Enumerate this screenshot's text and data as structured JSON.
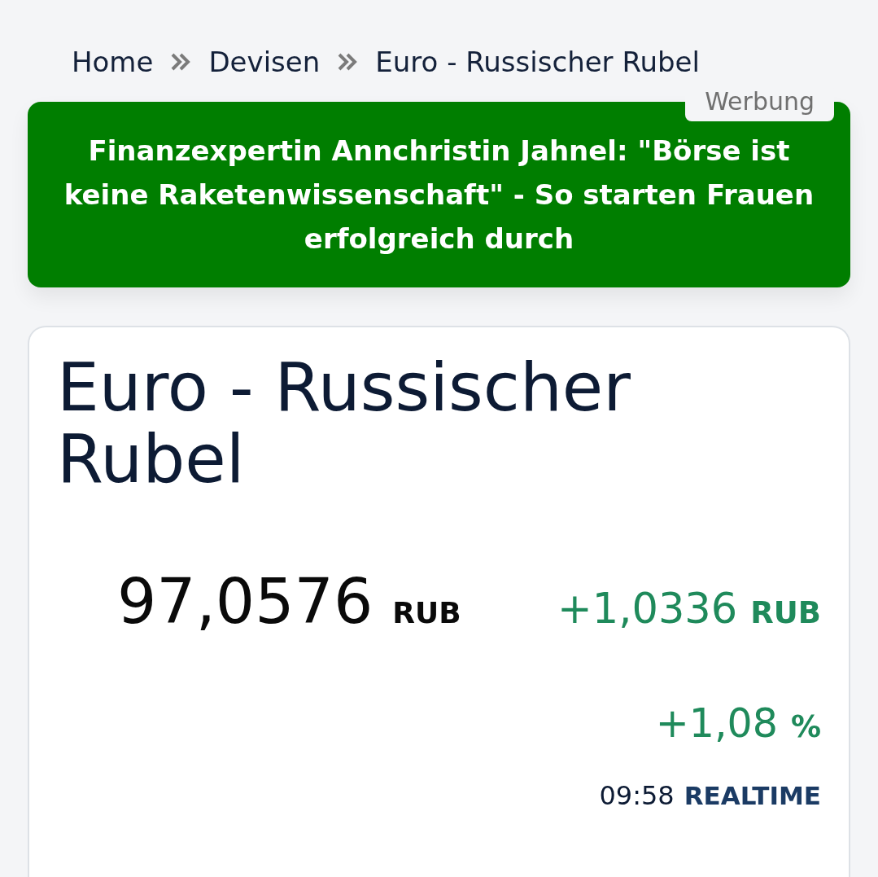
{
  "breadcrumb": [
    {
      "label": "Home"
    },
    {
      "label": "Devisen"
    },
    {
      "label": "Euro - Russischer Rubel"
    }
  ],
  "ad": {
    "badge": "Werbung",
    "text": "Finanzexpertin Annchristin Jahnel: \"Börse ist keine Raketenwissenschaft\" - So starten Frauen erfolgreich durch"
  },
  "quote": {
    "title": "Euro - Russischer Rubel",
    "price": "97,0576",
    "price_unit": "RUB",
    "change": {
      "positive": true,
      "value": "+1,0336",
      "unit": "RUB"
    },
    "change_percent": {
      "positive": true,
      "value": "+1,08",
      "unit": "%"
    },
    "time": "09:58",
    "source": "REALTIME"
  }
}
